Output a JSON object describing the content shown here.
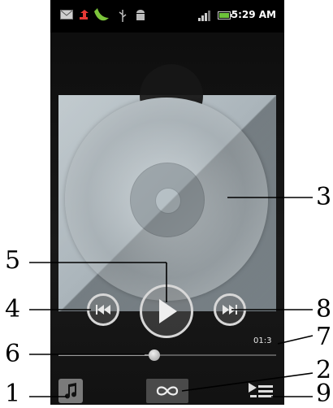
{
  "status_bar": {
    "time": "5:29 AM",
    "icons": [
      "mail-icon",
      "upload-icon",
      "app-icon",
      "usb-icon",
      "android-debug-icon",
      "signal-icon",
      "battery-icon"
    ]
  },
  "player": {
    "elapsed_time": "01:3",
    "progress_fraction": 0.44
  },
  "callouts": {
    "c1": "1",
    "c2": "2",
    "c3": "3",
    "c4": "4",
    "c5": "5",
    "c6": "6",
    "c7": "7",
    "c8": "8",
    "c9": "9"
  },
  "colors": {
    "background": "#191919",
    "control_ring": "#d7d7d7",
    "disc": "#b4bdc2"
  }
}
